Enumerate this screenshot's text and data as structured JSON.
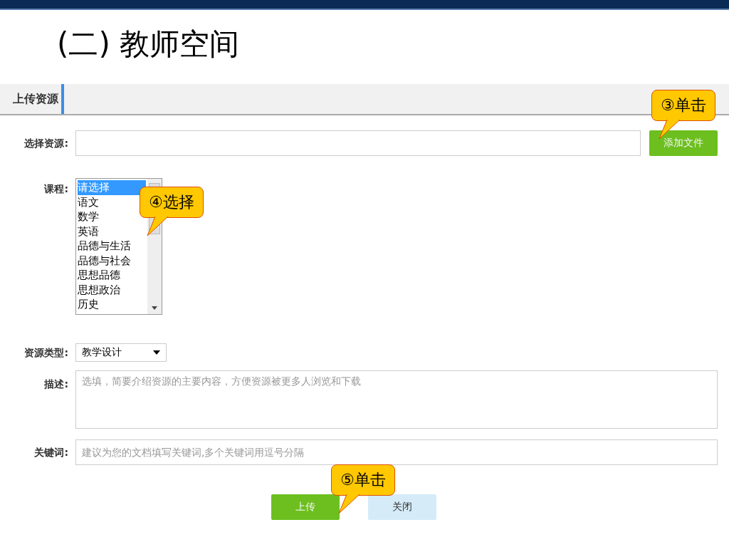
{
  "slide_title": "(二) 教师空间",
  "panel": {
    "title": "上传资源"
  },
  "resource": {
    "label": "选择资源:",
    "button": "添加文件"
  },
  "course": {
    "label": "课程:",
    "options": [
      {
        "label": "请选择",
        "selected": true
      },
      {
        "label": "语文",
        "selected": false
      },
      {
        "label": "数学",
        "selected": false
      },
      {
        "label": "英语",
        "selected": false
      },
      {
        "label": "品德与生活",
        "selected": false
      },
      {
        "label": "品德与社会",
        "selected": false
      },
      {
        "label": "思想品德",
        "selected": false
      },
      {
        "label": "思想政治",
        "selected": false
      },
      {
        "label": "历史",
        "selected": false
      }
    ]
  },
  "type": {
    "label": "资源类型:",
    "value": "教学设计"
  },
  "description": {
    "label": "描述:",
    "placeholder": "选填，简要介绍资源的主要内容，方便资源被更多人浏览和下载"
  },
  "keywords": {
    "label": "关键词:",
    "placeholder": "建议为您的文档填写关键词,多个关键词用逗号分隔"
  },
  "buttons": [
    {
      "label": "上传",
      "kind": "primary"
    },
    {
      "label": "关闭",
      "kind": "secondary"
    }
  ],
  "callouts": [
    {
      "text": "③单击"
    },
    {
      "text": "④选择"
    },
    {
      "text": "⑤单击"
    }
  ]
}
